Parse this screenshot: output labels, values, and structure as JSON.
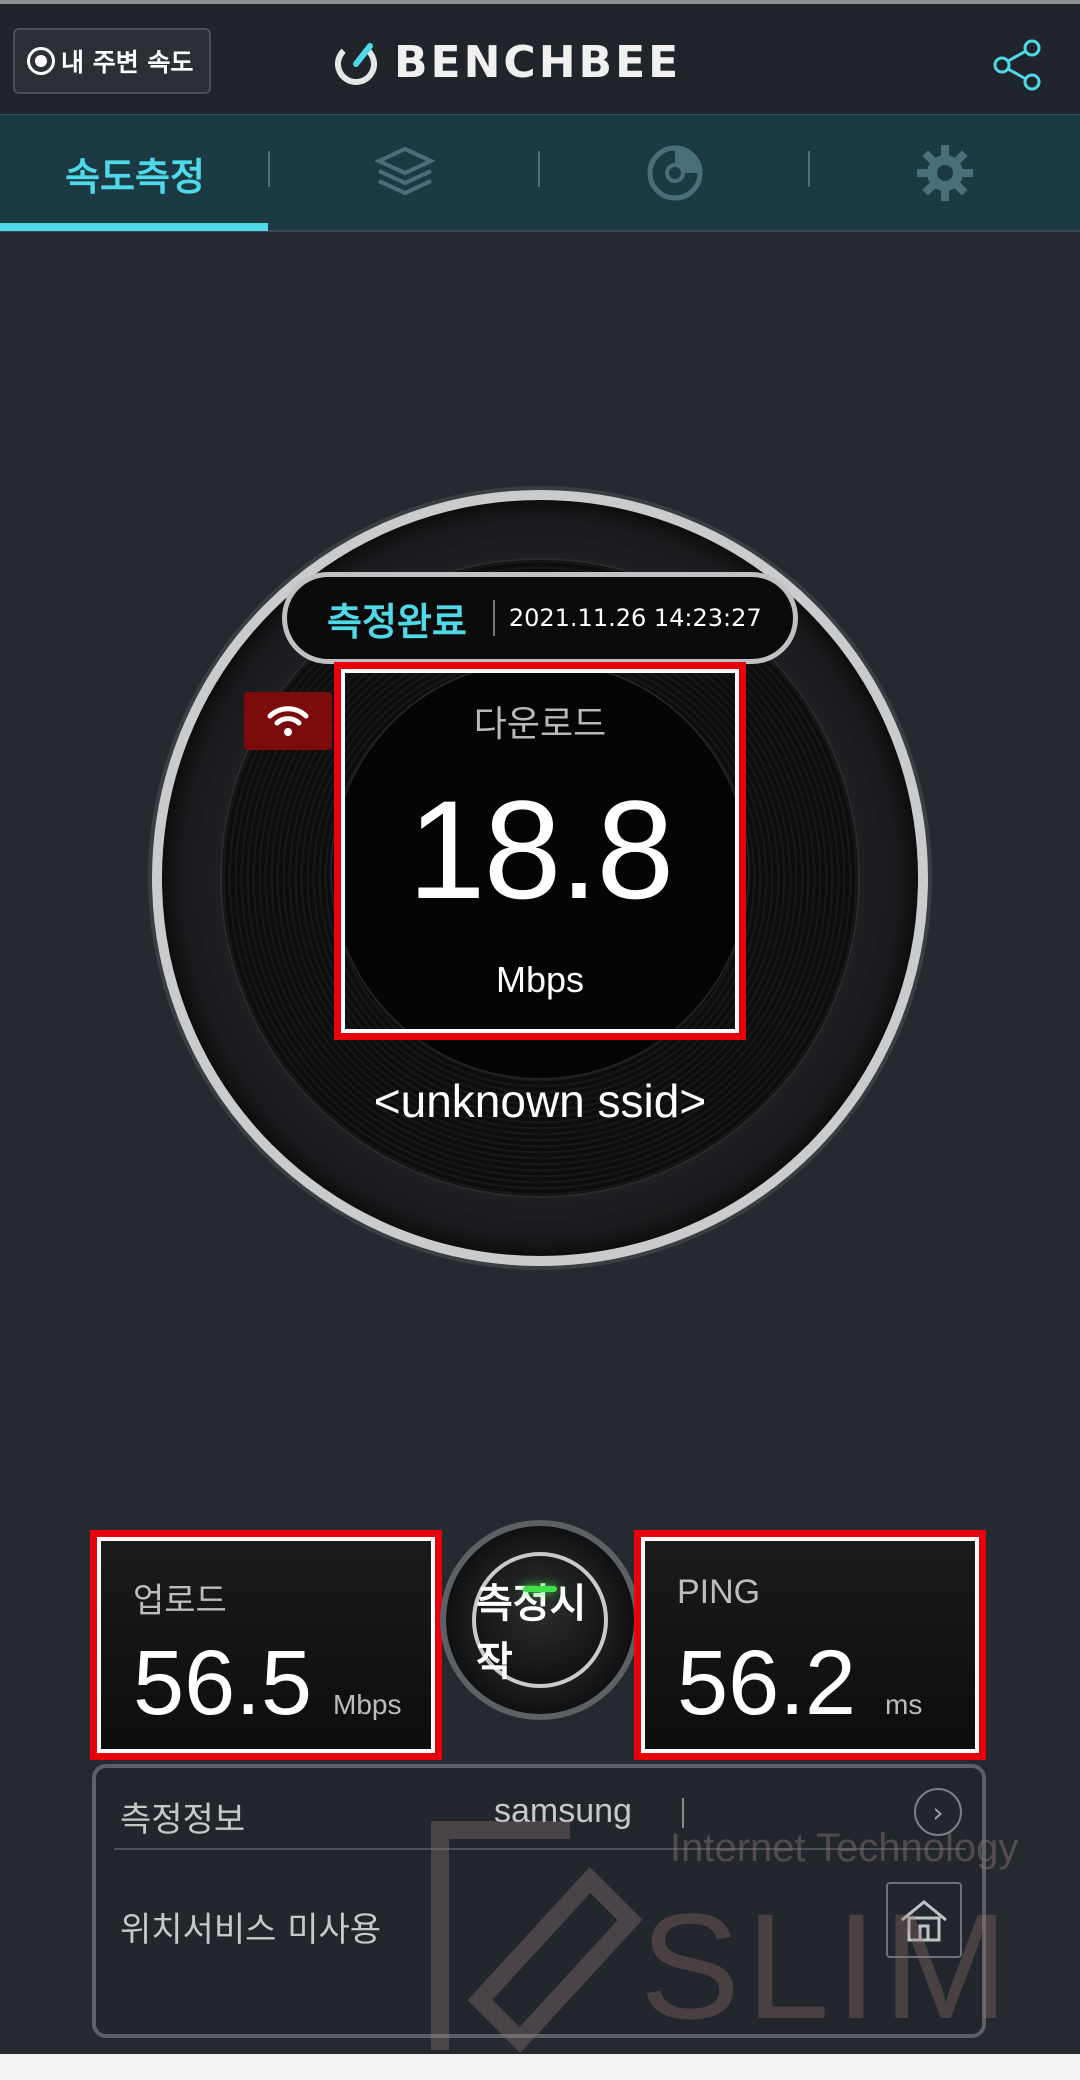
{
  "header": {
    "nearby_label": "내 주변 속도",
    "brand": "BENCHBEE"
  },
  "tabs": [
    {
      "label": "속도측정",
      "active": true
    },
    {
      "icon": "layers-icon"
    },
    {
      "icon": "history-icon"
    },
    {
      "icon": "gear-icon"
    }
  ],
  "gauge": {
    "status": "측정완료",
    "timestamp": "2021.11.26 14:23:27",
    "download_label": "다운로드",
    "download_value": "18.8",
    "download_unit": "Mbps",
    "ssid": "<unknown ssid>"
  },
  "upload": {
    "label": "업로드",
    "value": "56.5",
    "unit": "Mbps"
  },
  "ping": {
    "label": "PING",
    "value": "56.2",
    "unit": "ms"
  },
  "start_button": {
    "label": "측정시작"
  },
  "info": {
    "label": "측정정보",
    "carrier": "samsung",
    "location_label": "위치서비스 미사용"
  },
  "watermark": {
    "tagline": "Internet Technology",
    "name": "SLIM"
  },
  "colors": {
    "accent": "#4fd9e8",
    "highlight": "#e8000b",
    "background": "#252a31"
  }
}
